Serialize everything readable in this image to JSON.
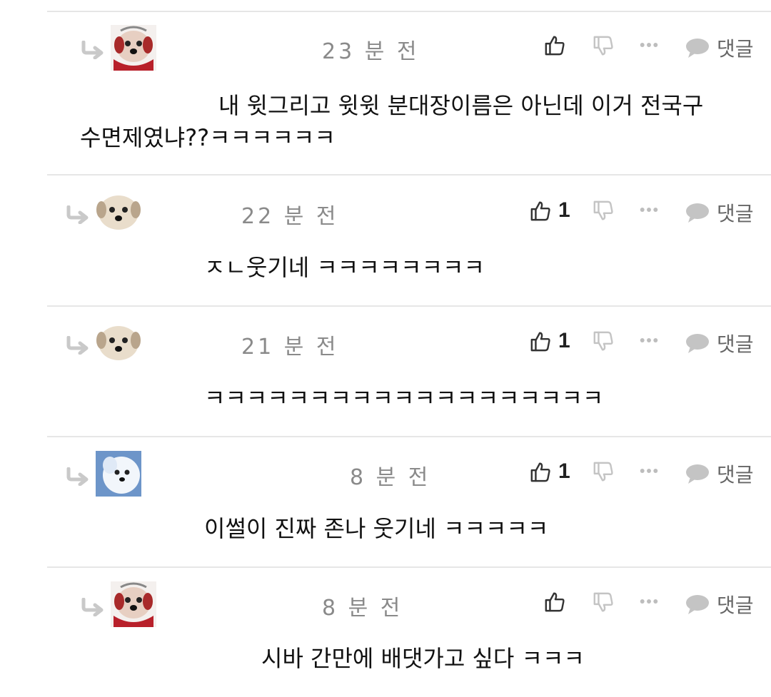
{
  "comments": [
    {
      "time": "23 분 전",
      "like_count": "",
      "reply_label": "댓글",
      "lines": [
        "내 윗그리고 윗윗 분대장이름은 아닌데 이거 전국구",
        "수면제였냐??ㅋㅋㅋㅋㅋㅋ"
      ],
      "avatar": "dog-red-scarf"
    },
    {
      "time": "22 분 전",
      "like_count": "1",
      "reply_label": "댓글",
      "lines": [
        "ㅈㄴ웃기네 ㅋㅋㅋㅋㅋㅋㅋㅋ"
      ],
      "avatar": "dog-face"
    },
    {
      "time": "21 분 전",
      "like_count": "1",
      "reply_label": "댓글",
      "lines": [
        "ㅋㅋㅋㅋㅋㅋㅋㅋㅋㅋㅋㅋㅋㅋㅋㅋㅋㅋㅋ"
      ],
      "avatar": "dog-face"
    },
    {
      "time": "8 분 전",
      "like_count": "1",
      "reply_label": "댓글",
      "lines": [
        "이썰이 진짜 존나 웃기네 ㅋㅋㅋㅋㅋ"
      ],
      "avatar": "dog-blue"
    },
    {
      "time": "8 분 전",
      "like_count": "",
      "reply_label": "댓글",
      "lines": [
        "시바 간만에 배댓가고 싶다 ㅋㅋㅋ"
      ],
      "avatar": "dog-red-scarf"
    }
  ],
  "icons": {
    "reply_arrow": "reply-arrow-icon",
    "like": "thumbs-up-icon",
    "dislike": "thumbs-down-icon",
    "more": "more-dots-icon",
    "reply": "speech-bubble-icon"
  },
  "colors": {
    "timestamp": "#8a8a8a",
    "icon_gray": "#bdbdbd",
    "icon_dark": "#333333",
    "divider": "#e6e6e6"
  }
}
